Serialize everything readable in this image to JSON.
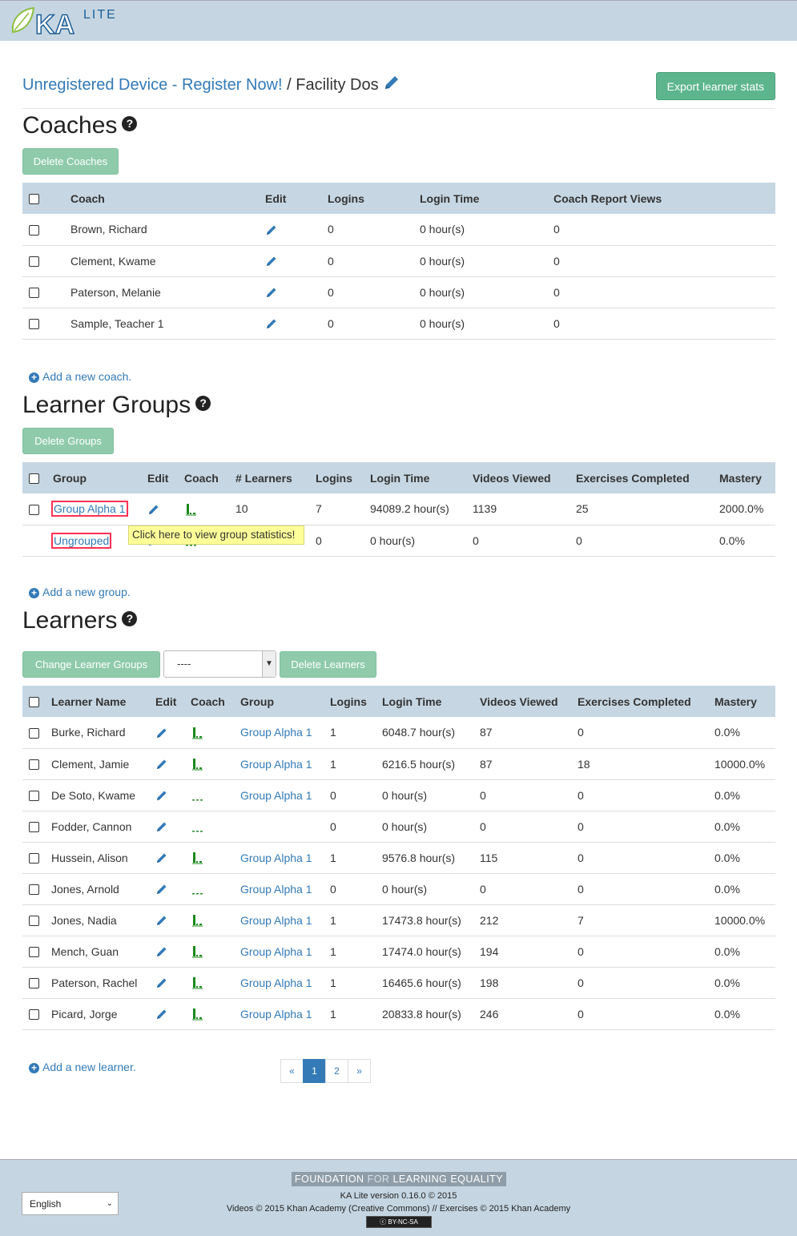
{
  "header": {
    "logo_text": "KA",
    "logo_sub": "LITE"
  },
  "breadcrumb": {
    "device_link": "Unregistered Device - Register Now!",
    "separator": " / ",
    "facility": "Facility Dos"
  },
  "export_button": "Export learner stats",
  "coaches": {
    "title": "Coaches",
    "delete_button": "Delete Coaches",
    "columns": [
      "Coach",
      "Edit",
      "Logins",
      "Login Time",
      "Coach Report Views"
    ],
    "rows": [
      {
        "name": "Brown, Richard",
        "logins": "0",
        "login_time": "0 hour(s)",
        "views": "0"
      },
      {
        "name": "Clement, Kwame",
        "logins": "0",
        "login_time": "0 hour(s)",
        "views": "0"
      },
      {
        "name": "Paterson, Melanie",
        "logins": "0",
        "login_time": "0 hour(s)",
        "views": "0"
      },
      {
        "name": "Sample, Teacher 1",
        "logins": "0",
        "login_time": "0 hour(s)",
        "views": "0"
      }
    ],
    "add_link": "Add a new coach."
  },
  "groups": {
    "title": "Learner Groups",
    "delete_button": "Delete Groups",
    "columns": [
      "Group",
      "Edit",
      "Coach",
      "# Learners",
      "Logins",
      "Login Time",
      "Videos Viewed",
      "Exercises Completed",
      "Mastery"
    ],
    "rows": [
      {
        "name": "Group Alpha 1",
        "learners": "10",
        "logins": "7",
        "login_time": "94089.2 hour(s)",
        "videos": "1139",
        "exercises": "25",
        "mastery": "2000.0%"
      },
      {
        "name": "Ungrouped",
        "learners": "",
        "logins": "0",
        "login_time": "0 hour(s)",
        "videos": "0",
        "exercises": "0",
        "mastery": "0.0%"
      }
    ],
    "tooltip": "Click here to view group statistics!",
    "add_link": "Add a new group."
  },
  "learners": {
    "title": "Learners",
    "change_button": "Change Learner Groups",
    "group_select": "----",
    "delete_button": "Delete Learners",
    "columns": [
      "Learner Name",
      "Edit",
      "Coach",
      "Group",
      "Logins",
      "Login Time",
      "Videos Viewed",
      "Exercises Completed",
      "Mastery"
    ],
    "rows": [
      {
        "name": "Burke, Richard",
        "active": true,
        "group": "Group Alpha 1",
        "logins": "1",
        "login_time": "6048.7 hour(s)",
        "videos": "87",
        "exercises": "0",
        "mastery": "0.0%"
      },
      {
        "name": "Clement, Jamie",
        "active": true,
        "group": "Group Alpha 1",
        "logins": "1",
        "login_time": "6216.5 hour(s)",
        "videos": "87",
        "exercises": "18",
        "mastery": "10000.0%"
      },
      {
        "name": "De Soto, Kwame",
        "active": false,
        "group": "Group Alpha 1",
        "logins": "0",
        "login_time": "0 hour(s)",
        "videos": "0",
        "exercises": "0",
        "mastery": "0.0%"
      },
      {
        "name": "Fodder, Cannon",
        "active": false,
        "group": "",
        "logins": "0",
        "login_time": "0 hour(s)",
        "videos": "0",
        "exercises": "0",
        "mastery": "0.0%"
      },
      {
        "name": "Hussein, Alison",
        "active": true,
        "group": "Group Alpha 1",
        "logins": "1",
        "login_time": "9576.8 hour(s)",
        "videos": "115",
        "exercises": "0",
        "mastery": "0.0%"
      },
      {
        "name": "Jones, Arnold",
        "active": false,
        "group": "Group Alpha 1",
        "logins": "0",
        "login_time": "0 hour(s)",
        "videos": "0",
        "exercises": "0",
        "mastery": "0.0%"
      },
      {
        "name": "Jones, Nadia",
        "active": true,
        "group": "Group Alpha 1",
        "logins": "1",
        "login_time": "17473.8 hour(s)",
        "videos": "212",
        "exercises": "7",
        "mastery": "10000.0%"
      },
      {
        "name": "Mench, Guan",
        "active": true,
        "group": "Group Alpha 1",
        "logins": "1",
        "login_time": "17474.0 hour(s)",
        "videos": "194",
        "exercises": "0",
        "mastery": "0.0%"
      },
      {
        "name": "Paterson, Rachel",
        "active": true,
        "group": "Group Alpha 1",
        "logins": "1",
        "login_time": "16465.6 hour(s)",
        "videos": "198",
        "exercises": "0",
        "mastery": "0.0%"
      },
      {
        "name": "Picard, Jorge",
        "active": true,
        "group": "Group Alpha 1",
        "logins": "1",
        "login_time": "20833.8 hour(s)",
        "videos": "246",
        "exercises": "0",
        "mastery": "0.0%"
      }
    ],
    "add_link": "Add a new learner.",
    "pager": {
      "prev": "«",
      "pages": [
        "1",
        "2"
      ],
      "current": "1",
      "next": "»"
    }
  },
  "footer": {
    "fle_foundation": "FOUNDATION",
    "fle_for": "FOR",
    "fle_rest": "LEARNING EQUALITY",
    "version": "KA Lite version 0.16.0 © 2015",
    "copyright": "Videos © 2015 Khan Academy (Creative Commons) // Exercises © 2015 Khan Academy",
    "license_badge": "BY-NC-SA",
    "language": "English"
  },
  "colors": {
    "link": "#337ab7",
    "green_button": "#5cb58c",
    "header_bg": "#c5d6e2",
    "chart_green": "#1a8a1a"
  }
}
